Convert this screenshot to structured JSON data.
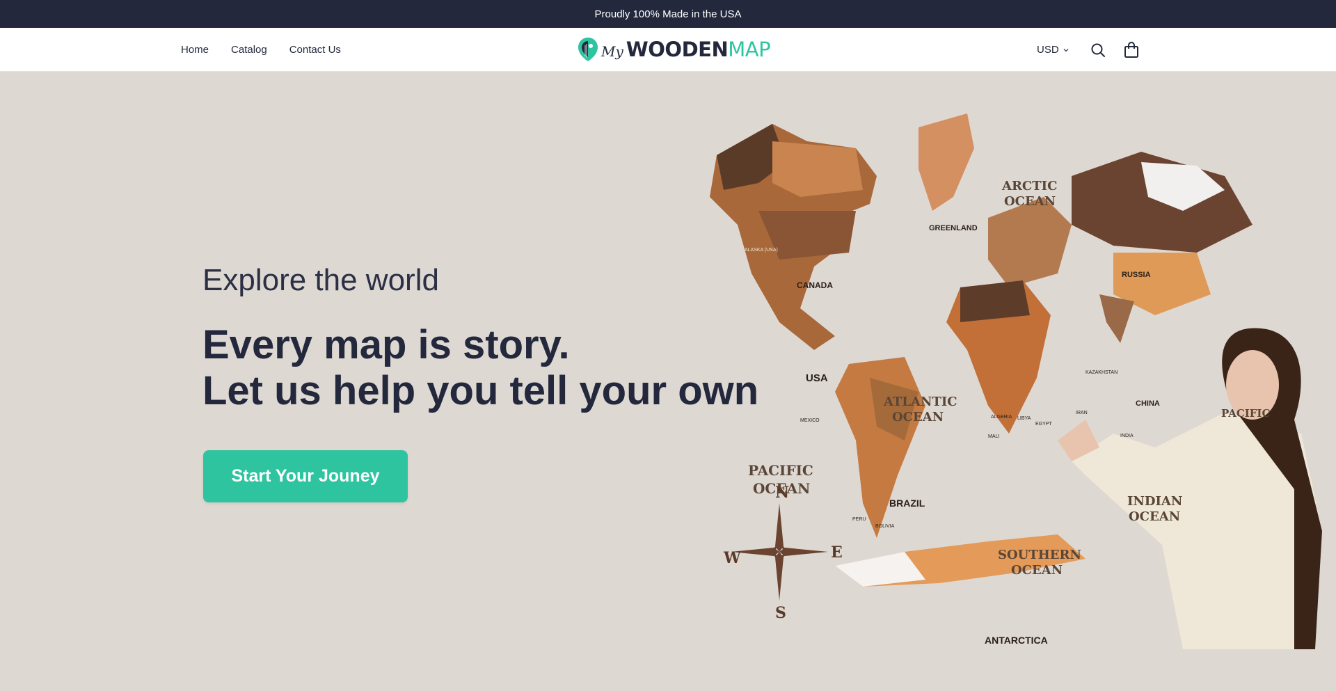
{
  "announcement": {
    "text": "Proudly 100% Made in the USA"
  },
  "nav": {
    "items": [
      "Home",
      "Catalog",
      "Contact Us"
    ]
  },
  "logo": {
    "my": "My",
    "wooden": "WOODEN",
    "map": "MAP"
  },
  "header": {
    "currency": "USD"
  },
  "hero": {
    "subtitle": "Explore the world",
    "title_line1": "Every map is story.",
    "title_line2": "Let us help you tell your own",
    "cta_label": "Start Your Jouney"
  },
  "map_labels": {
    "oceans": [
      "ARCTIC",
      "OCEAN",
      "ATLANTIC",
      "OCEAN",
      "PACIFIC",
      "OCEAN",
      "INDIAN",
      "OCEAN",
      "SOUTHERN",
      "OCEAN",
      "PACIFIC"
    ],
    "regions": [
      "GREENLAND",
      "CANADA",
      "USA",
      "BRAZIL",
      "RUSSIA",
      "CHINA",
      "ANTARCTICA",
      "ALASKA (USA)",
      "MEXICO",
      "KAZAKHSTAN",
      "INDIA",
      "IRAN",
      "MALI",
      "LIBYA",
      "EGYPT",
      "ALGERIA",
      "BOLIVIA",
      "PERU"
    ],
    "compass": [
      "N",
      "S",
      "E",
      "W"
    ]
  },
  "colors": {
    "announcement_bg": "#23283d",
    "brand_teal": "#2ec4a0",
    "hero_bg": "#ded8d3",
    "text_dark": "#23283d"
  },
  "icons": [
    "chevron-down-icon",
    "search-icon",
    "cart-bag-icon",
    "logo-mark-icon"
  ]
}
